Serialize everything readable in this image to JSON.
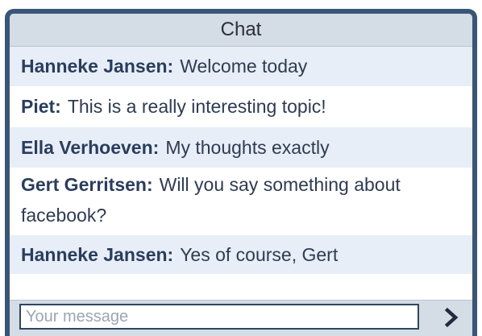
{
  "chat": {
    "title": "Chat",
    "messages": [
      {
        "author": "Hanneke Jansen:",
        "text": "Welcome today"
      },
      {
        "author": "Piet:",
        "text": "This is a really interesting topic!"
      },
      {
        "author": "Ella Verhoeven:",
        "text": "My thoughts exactly"
      },
      {
        "author": "Gert Gerritsen:",
        "text": "Will you say something about facebook?"
      },
      {
        "author": "Hanneke Jansen:",
        "text": "Yes of course, Gert"
      }
    ],
    "input_placeholder": "Your message",
    "send_icon": "chevron-right-icon"
  },
  "colors": {
    "frame": "#3a5677",
    "header_bg": "#d4dce6",
    "alt_row_bg": "#e7eef7",
    "author_text": "#2a3d5d"
  }
}
